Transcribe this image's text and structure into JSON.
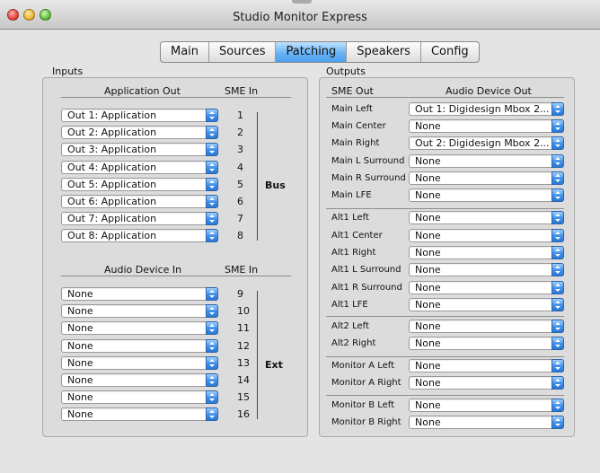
{
  "window": {
    "title": "Studio Monitor Express"
  },
  "tabs": [
    {
      "label": "Main",
      "selected": false
    },
    {
      "label": "Sources",
      "selected": false
    },
    {
      "label": "Patching",
      "selected": true
    },
    {
      "label": "Speakers",
      "selected": false
    },
    {
      "label": "Config",
      "selected": false
    }
  ],
  "inputs": {
    "label": "Inputs",
    "app_header": "Application Out",
    "sme_header": "SME In",
    "app_rows": [
      {
        "value": "Out 1: Application",
        "sme": "1"
      },
      {
        "value": "Out 2: Application",
        "sme": "2"
      },
      {
        "value": "Out 3: Application",
        "sme": "3"
      },
      {
        "value": "Out 4: Application",
        "sme": "4"
      },
      {
        "value": "Out 5: Application",
        "sme": "5"
      },
      {
        "value": "Out 6: Application",
        "sme": "6"
      },
      {
        "value": "Out 7: Application",
        "sme": "7"
      },
      {
        "value": "Out 8: Application",
        "sme": "8"
      }
    ],
    "bus_label": "Bus",
    "dev_header": "Audio Device In",
    "dev_sme_header": "SME In",
    "dev_rows": [
      {
        "value": "None",
        "sme": "9"
      },
      {
        "value": "None",
        "sme": "10"
      },
      {
        "value": "None",
        "sme": "11"
      },
      {
        "value": "None",
        "sme": "12"
      },
      {
        "value": "None",
        "sme": "13"
      },
      {
        "value": "None",
        "sme": "14"
      },
      {
        "value": "None",
        "sme": "15"
      },
      {
        "value": "None",
        "sme": "16"
      }
    ],
    "ext_label": "Ext"
  },
  "outputs": {
    "label": "Outputs",
    "sme_header": "SME Out",
    "dev_header": "Audio Device Out",
    "rows": [
      {
        "label": "Main Left",
        "value": "Out 1: Digidesign Mbox 2..."
      },
      {
        "label": "Main Center",
        "value": "None"
      },
      {
        "label": "Main Right",
        "value": "Out 2: Digidesign Mbox 2..."
      },
      {
        "label": "Main L Surround",
        "value": "None"
      },
      {
        "label": "Main R Surround",
        "value": "None"
      },
      {
        "label": "Main LFE",
        "value": "None"
      },
      {
        "label": "Alt1 Left",
        "value": "None"
      },
      {
        "label": "Alt1 Center",
        "value": "None"
      },
      {
        "label": "Alt1 Right",
        "value": "None"
      },
      {
        "label": "Alt1 L Surround",
        "value": "None"
      },
      {
        "label": "Alt1 R Surround",
        "value": "None"
      },
      {
        "label": "Alt1 LFE",
        "value": "None"
      },
      {
        "label": "Alt2 Left",
        "value": "None"
      },
      {
        "label": "Alt2 Right",
        "value": "None"
      },
      {
        "label": "Monitor A Left",
        "value": "None"
      },
      {
        "label": "Monitor A Right",
        "value": "None"
      },
      {
        "label": "Monitor B Left",
        "value": "None"
      },
      {
        "label": "Monitor B Right",
        "value": "None"
      }
    ]
  }
}
